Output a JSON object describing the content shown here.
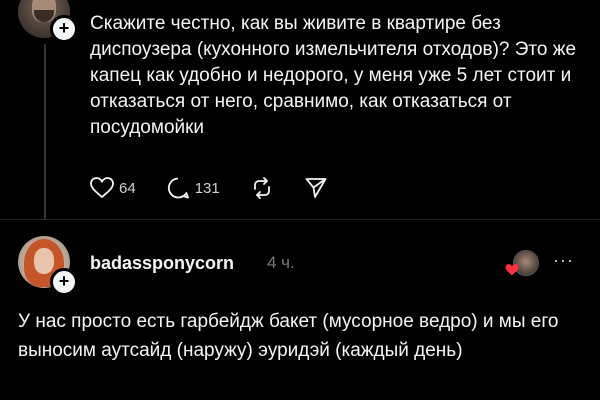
{
  "post": {
    "text": "Скажите честно, как вы живите в квартире без диспоузера (кухонного измельчителя отходов)? Это же капец как удобно и недорого, у меня уже 5 лет стоит и отказаться от него, сравнимо, как отказаться от посудомойки",
    "likes": "64",
    "replies": "131"
  },
  "reply": {
    "username": "badassponycorn",
    "timestamp": "4 ч.",
    "text": "У нас просто есть гарбейдж бакет (мусорное ведро) и мы его выносим аутсайд (наружу) эуридэй (каждый день)",
    "more_label": "···"
  },
  "colors": {
    "background": "#000000",
    "text": "#f3f5f7",
    "muted": "#777a7e",
    "heart_liked": "#ff3040"
  },
  "icons": [
    "heart-icon",
    "comment-icon",
    "repost-icon",
    "share-icon",
    "plus-icon",
    "more-icon"
  ]
}
